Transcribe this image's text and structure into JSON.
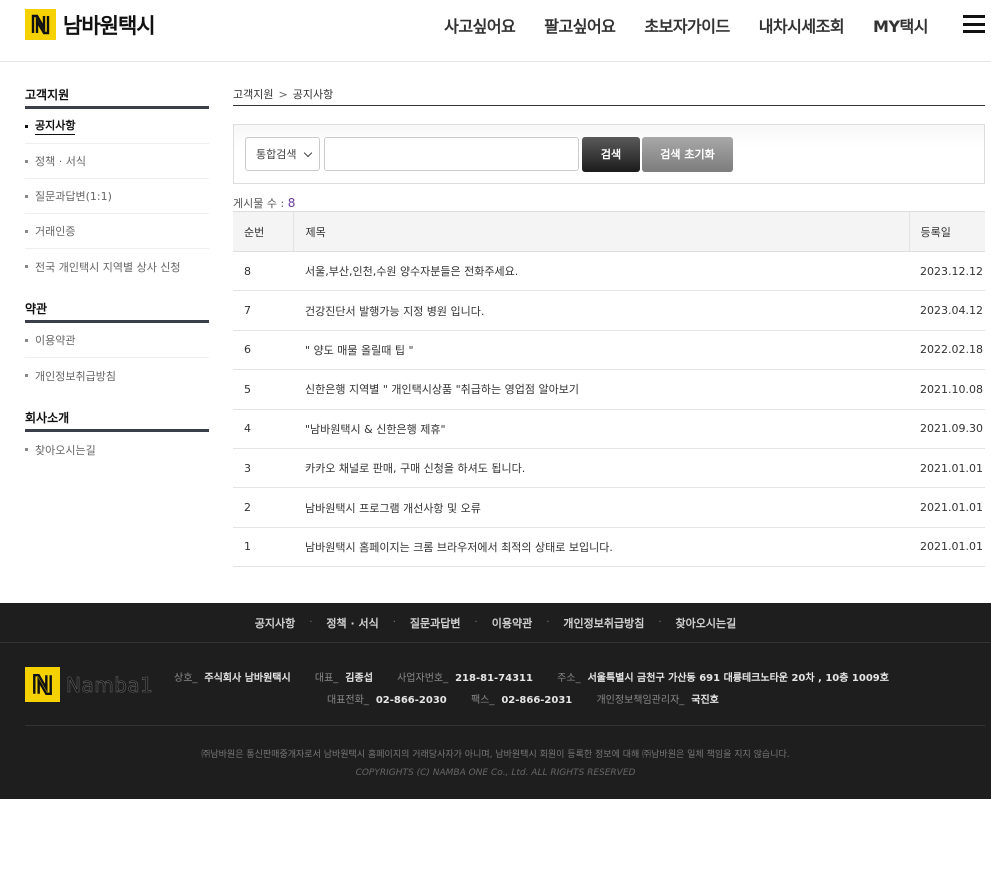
{
  "header": {
    "logo_text": "남바원택시",
    "nav": [
      "사고싶어요",
      "팔고싶어요",
      "초보자가이드",
      "내차시세조회",
      "MY택시"
    ]
  },
  "sidebar": {
    "groups": [
      {
        "title": "고객지원",
        "items": [
          "공지사항",
          "정책 · 서식",
          "질문과답변(1:1)",
          "거래인증",
          "전국 개인택시 지역별 상사 신청"
        ]
      },
      {
        "title": "약관",
        "items": [
          "이용약관",
          "개인정보취급방침"
        ]
      },
      {
        "title": "회사소개",
        "items": [
          "찾아오시는길"
        ]
      }
    ]
  },
  "breadcrumb": {
    "home": "고객지원",
    "sep": ">",
    "current": "공지사항"
  },
  "search": {
    "select_value": "통합검색",
    "input_value": "",
    "search_label": "검색",
    "reset_label": "검색 초기화"
  },
  "count": {
    "label": "게시물 수 :",
    "value": "8"
  },
  "table": {
    "headers": {
      "no": "순번",
      "title": "제목",
      "date": "등록일"
    },
    "rows": [
      {
        "no": "8",
        "title": "서울,부산,인천,수원 양수자분들은 전화주세요.",
        "date": "2023.12.12"
      },
      {
        "no": "7",
        "title": "건강진단서 발행가능 지정 병원 입니다.",
        "date": "2023.04.12"
      },
      {
        "no": "6",
        "title": "\" 양도 매물 올릴때 팁 \"",
        "date": "2022.02.18"
      },
      {
        "no": "5",
        "title": "신한은행 지역별 \" 개인택시상품 \"취급하는 영업점 알아보기",
        "date": "2021.10.08"
      },
      {
        "no": "4",
        "title": "\"남바원택시 & 신한은행 제휴\"",
        "date": "2021.09.30"
      },
      {
        "no": "3",
        "title": "카카오 채널로 판매, 구매 신청을 하셔도 됩니다.",
        "date": "2021.01.01"
      },
      {
        "no": "2",
        "title": "남바원택시 프로그램 개선사항 및 오류",
        "date": "2021.01.01"
      },
      {
        "no": "1",
        "title": "남바원택시 홈페이지는 크롬 브라우저에서 최적의 상태로 보입니다.",
        "date": "2021.01.01"
      }
    ]
  },
  "footer": {
    "links": [
      "공지사항",
      "정책 · 서식",
      "질문과답변",
      "이용약관",
      "개인정보취급방침",
      "찾아오시는길"
    ],
    "logo_text": "Namba1",
    "info": {
      "company_k": "상호_",
      "company_v": "주식회사 남바원택시",
      "ceo_k": "대표_",
      "ceo_v": "김종섭",
      "biz_k": "사업자번호_",
      "biz_v": "218-81-74311",
      "addr_k": "주소_",
      "addr_v": "서울특별시 금천구 가산동 691 대륭테크노타운 20차 , 10층 1009호",
      "tel_k": "대표전화_",
      "tel_v": "02-866-2030",
      "fax_k": "팩스_",
      "fax_v": "02-866-2031",
      "privacy_k": "개인정보책임관리자_",
      "privacy_v": "국진호"
    },
    "disclaimer": "㈜남바원은 통신판매중개자로서 남바원택시 홈페이지의 거래당사자가 아니며, 남바원택시 회원이 등록한 정보에 대해 ㈜남바원은 일체 책임을 지지 않습니다.",
    "copyright": "COPYRIGHTS (C) NAMBA ONE Co., Ltd. ALL RIGHTS RESERVED"
  },
  "colors": {
    "brand_yellow": "#f6d100",
    "footer_bg": "#1e1e1e",
    "count_accent": "#6a3aa0"
  }
}
